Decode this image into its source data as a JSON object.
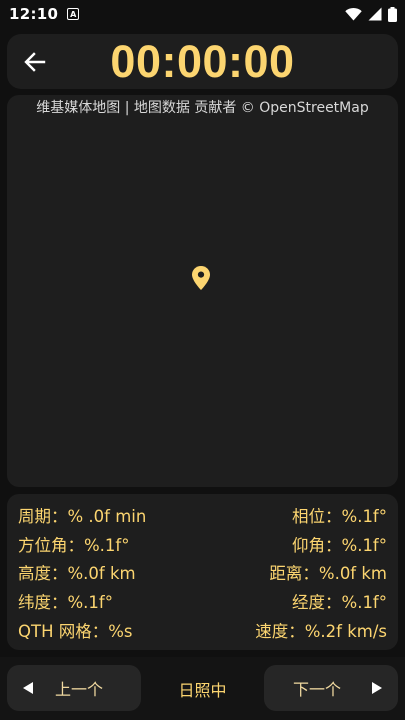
{
  "status_bar": {
    "time": "12:10",
    "badge": "A",
    "icons": [
      "wifi-icon",
      "cellular-signal-icon",
      "battery-icon"
    ]
  },
  "header": {
    "timer": "00:00:00",
    "back_icon": "arrow-left-icon"
  },
  "map": {
    "attribution": "维基媒体地图 | 地图数据 贡献者 © OpenStreetMap",
    "marker_icon": "location-pin-icon"
  },
  "info": {
    "rows": [
      {
        "left": "周期：% .0f min",
        "right": "相位：%.1f°"
      },
      {
        "left": "方位角：%.1f°",
        "right": "仰角：%.1f°"
      },
      {
        "left": "高度：%.0f km",
        "right": "距离：%.0f km"
      },
      {
        "left": "纬度：%.1f°",
        "right": "经度：%.1f°"
      },
      {
        "left": "QTH 网格：%s",
        "right": "速度：%.2f km/s"
      }
    ]
  },
  "bottom": {
    "prev_label": "上一个",
    "next_label": "下一个",
    "status": "日照中"
  },
  "colors": {
    "accent": "#fcd570",
    "card": "#1e1e1e",
    "background": "#101010"
  }
}
